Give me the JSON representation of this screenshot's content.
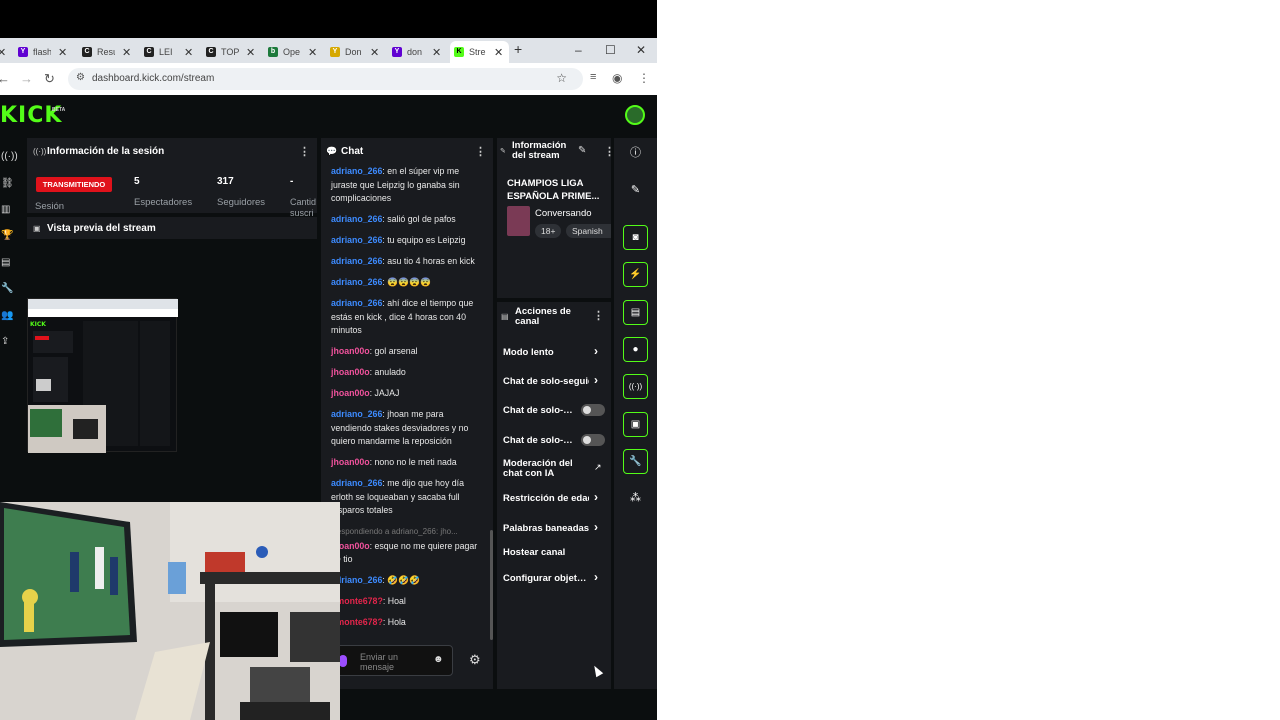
{
  "browser": {
    "tabs": [
      {
        "label": "flash",
        "icon": "yahoo-icon",
        "color": "#6001d2"
      },
      {
        "label": "Resu",
        "icon": "chess-icon",
        "color": "#222222"
      },
      {
        "label": "LEI",
        "icon": "chess-icon",
        "color": "#222222"
      },
      {
        "label": "TOP",
        "icon": "chess-icon",
        "color": "#222222"
      },
      {
        "label": "Ope",
        "icon": "bet365-icon",
        "color": "#1d7a3c"
      },
      {
        "label": "Don",
        "icon": "yahoo-sports-icon",
        "color": "#d6a800"
      },
      {
        "label": "don",
        "icon": "yahoo-icon",
        "color": "#6001d2"
      },
      {
        "label": "Stre",
        "icon": "kick-icon",
        "color": "#53fc18"
      }
    ],
    "url": "dashboard.kick.com/stream"
  },
  "brand": {
    "logo": "KICK",
    "beta": "BETA",
    "accent": "#53fc18"
  },
  "session": {
    "title": "Información de la sesión",
    "badge": "TRANSMITIENDO",
    "session_label": "Sesión",
    "stats": [
      {
        "value": "5",
        "label": "Espectadores"
      },
      {
        "value": "317",
        "label": "Seguidores"
      },
      {
        "value": "-",
        "label": "Cantid suscri"
      }
    ]
  },
  "preview": {
    "title": "Vista previa del stream"
  },
  "chat": {
    "title": "Chat",
    "input_placeholder": "Enviar un mensaje",
    "messages": [
      {
        "user": "adriano_266",
        "text": "en el súper vip me juraste que Leipzig lo ganaba sin complicaciones",
        "color": "#3d8bff"
      },
      {
        "user": "adriano_266",
        "text": "salió gol de pafos",
        "color": "#3d8bff"
      },
      {
        "user": "adriano_266",
        "text": "tu equipo es Leipzig",
        "color": "#3d8bff"
      },
      {
        "user": "adriano_266",
        "text": "asu tio 4 horas en kick",
        "color": "#3d8bff"
      },
      {
        "user": "adriano_266",
        "text": "😨😨😨😨",
        "color": "#3d8bff"
      },
      {
        "user": "adriano_266",
        "text": "ahí dice el tiempo que estás en kick , dice 4 horas con 40 minutos",
        "color": "#3d8bff"
      },
      {
        "user": "jhoan00o",
        "text": "gol arsenal",
        "color": "#f0529c"
      },
      {
        "user": "jhoan00o",
        "text": "anulado",
        "color": "#f0529c"
      },
      {
        "user": "jhoan00o",
        "text": "JAJAJ",
        "color": "#f0529c"
      },
      {
        "user": "adriano_266",
        "text": "jhoan me para vendiendo stakes desviadores y no quiero mandarme la reposición",
        "color": "#3d8bff"
      },
      {
        "user": "jhoan00o",
        "text": "nono no le meti nada",
        "color": "#f0529c"
      },
      {
        "user": "adriano_266",
        "text": "me dijo que hoy día erloth se loqueaban y sacaba full disparos totales",
        "color": "#3d8bff"
      },
      {
        "reply": "Respondiendo a adriano_266: jho...",
        "user": "jhoan00o",
        "text": "esque no me quiere pagar pe tio",
        "color": "#f0529c"
      },
      {
        "user": "adriano_266",
        "text": "🤣🤣🤣",
        "color": "#3d8bff"
      },
      {
        "user": "omonte678?",
        "text": "Hoal",
        "color": "#e2254b"
      },
      {
        "user": "omonte678?",
        "text": "Hola",
        "color": "#e2254b"
      }
    ]
  },
  "stream_info": {
    "title": "Información del stream",
    "stream_title": "CHAMPIOS LIGA ESPAÑOLA PRIME...",
    "category": "Conversando",
    "tags": [
      "18+",
      "Spanish"
    ]
  },
  "channel_actions": {
    "title": "Acciones de canal",
    "items": [
      {
        "label": "Modo lento",
        "kind": "chevron"
      },
      {
        "label": "Chat de solo-seguidores",
        "kind": "chevron"
      },
      {
        "label": "Chat de solo-suscriptores",
        "kind": "toggle"
      },
      {
        "label": "Chat de solo-emotes",
        "kind": "toggle"
      },
      {
        "label": "Moderación del chat con IA",
        "kind": "external"
      },
      {
        "label": "Restricción de edad",
        "kind": "chevron"
      },
      {
        "label": "Palabras baneadas",
        "kind": "chevron"
      },
      {
        "label": "Hostear canal",
        "kind": "none"
      },
      {
        "label": "Configurar objetivos",
        "kind": "chevron"
      }
    ]
  }
}
